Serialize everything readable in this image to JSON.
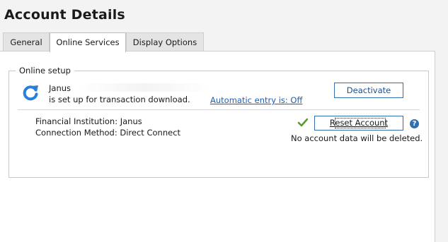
{
  "header": {
    "title": "Account Details"
  },
  "tabs": [
    {
      "label": "General",
      "active": false
    },
    {
      "label": "Online Services",
      "active": true
    },
    {
      "label": "Display Options",
      "active": false
    }
  ],
  "online_setup": {
    "legend": "Online setup",
    "institution_short": "Janus",
    "setup_status": "is set up for transaction download.",
    "automatic_entry_link": "Automatic entry is: Off",
    "deactivate_label": "Deactivate",
    "financial_institution": "Financial Institution: Janus",
    "connection_method": "Connection Method: Direct Connect",
    "reset_label": "Reset Account",
    "reset_note": "No account data will be deleted.",
    "help_glyph": "?"
  },
  "icons": {
    "refresh": "refresh-icon",
    "check": "checkmark-icon",
    "help": "help-icon"
  },
  "colors": {
    "accent": "#2f6fb0",
    "link": "#1e5fb3",
    "check": "#5a9a2a",
    "background": "#f3f3f3"
  }
}
